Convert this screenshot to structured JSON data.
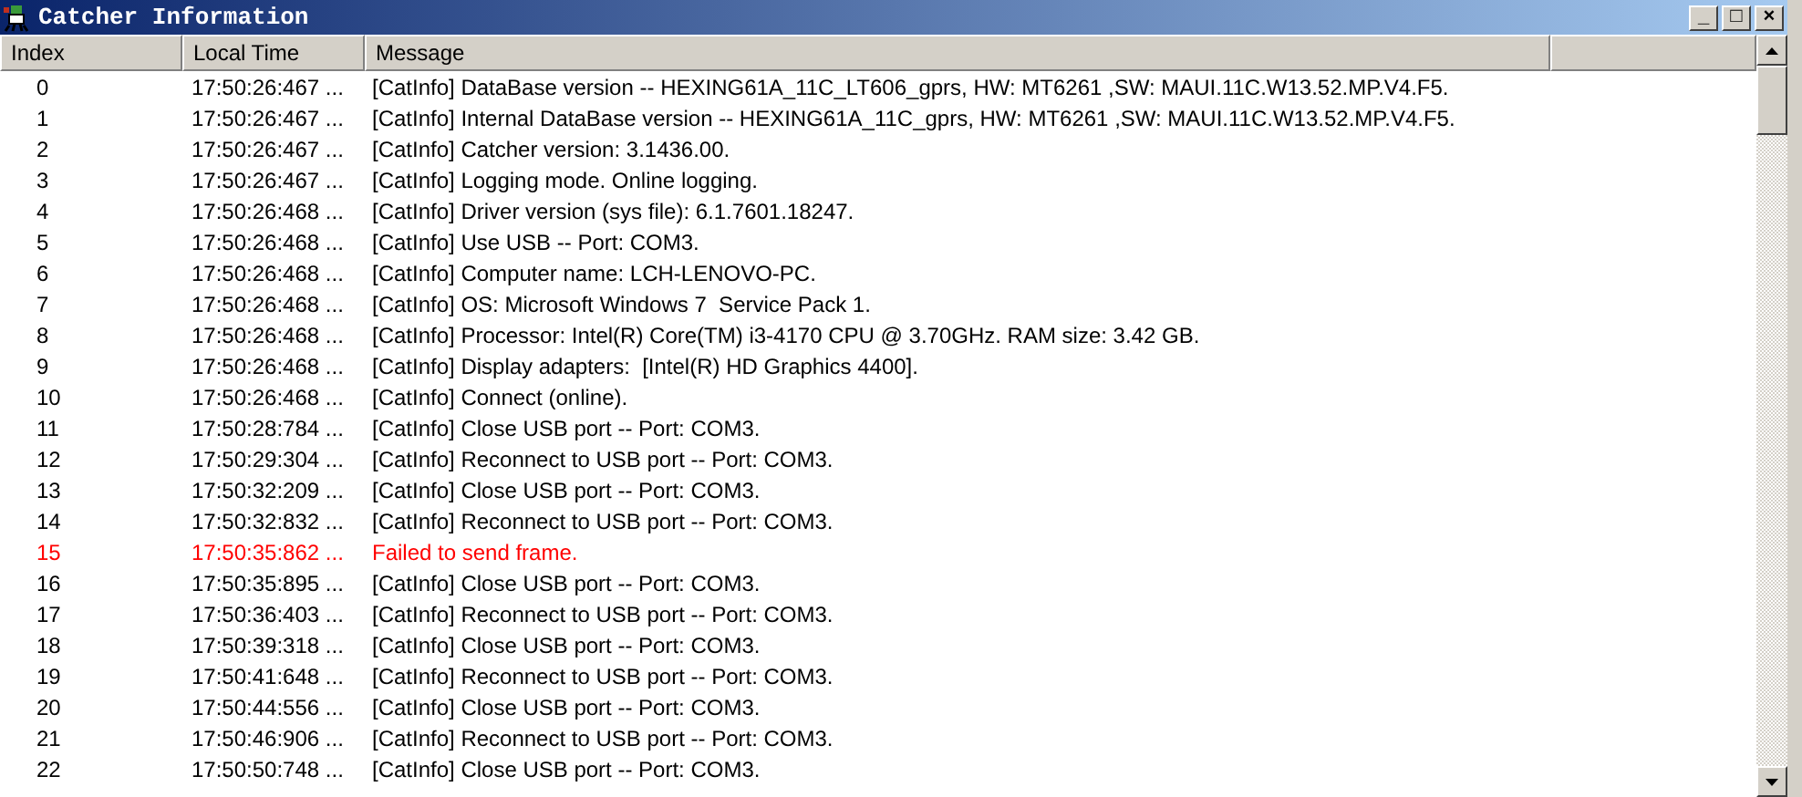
{
  "window": {
    "title": "Catcher Information",
    "controls": [
      "_",
      "□",
      "×"
    ]
  },
  "table": {
    "columns": [
      "Index",
      "Local Time",
      "Message"
    ],
    "rows": [
      {
        "index": "0",
        "time": "17:50:26:467 ...",
        "message": "[CatInfo] DataBase version -- HEXING61A_11C_LT606_gprs, HW: MT6261 ,SW: MAUI.11C.W13.52.MP.V4.F5.",
        "kind": "info"
      },
      {
        "index": "1",
        "time": "17:50:26:467 ...",
        "message": "[CatInfo] Internal DataBase version -- HEXING61A_11C_gprs, HW: MT6261 ,SW: MAUI.11C.W13.52.MP.V4.F5.",
        "kind": "info"
      },
      {
        "index": "2",
        "time": "17:50:26:467 ...",
        "message": "[CatInfo] Catcher version: 3.1436.00.",
        "kind": "info"
      },
      {
        "index": "3",
        "time": "17:50:26:467 ...",
        "message": "[CatInfo] Logging mode. Online logging.",
        "kind": "info"
      },
      {
        "index": "4",
        "time": "17:50:26:468 ...",
        "message": "[CatInfo] Driver version (sys file): 6.1.7601.18247.",
        "kind": "info"
      },
      {
        "index": "5",
        "time": "17:50:26:468 ...",
        "message": "[CatInfo] Use USB -- Port: COM3.",
        "kind": "info"
      },
      {
        "index": "6",
        "time": "17:50:26:468 ...",
        "message": "[CatInfo] Computer name: LCH-LENOVO-PC.",
        "kind": "info"
      },
      {
        "index": "7",
        "time": "17:50:26:468 ...",
        "message": "[CatInfo] OS: Microsoft Windows 7  Service Pack 1.",
        "kind": "info"
      },
      {
        "index": "8",
        "time": "17:50:26:468 ...",
        "message": "[CatInfo] Processor: Intel(R) Core(TM) i3-4170 CPU @ 3.70GHz. RAM size: 3.42 GB.",
        "kind": "info"
      },
      {
        "index": "9",
        "time": "17:50:26:468 ...",
        "message": "[CatInfo] Display adapters:  [Intel(R) HD Graphics 4400].",
        "kind": "info"
      },
      {
        "index": "10",
        "time": "17:50:26:468 ...",
        "message": "[CatInfo] Connect (online).",
        "kind": "info"
      },
      {
        "index": "11",
        "time": "17:50:28:784 ...",
        "message": "[CatInfo] Close USB port -- Port: COM3.",
        "kind": "info"
      },
      {
        "index": "12",
        "time": "17:50:29:304 ...",
        "message": "[CatInfo] Reconnect to USB port -- Port: COM3.",
        "kind": "info"
      },
      {
        "index": "13",
        "time": "17:50:32:209 ...",
        "message": "[CatInfo] Close USB port -- Port: COM3.",
        "kind": "info"
      },
      {
        "index": "14",
        "time": "17:50:32:832 ...",
        "message": "[CatInfo] Reconnect to USB port -- Port: COM3.",
        "kind": "info"
      },
      {
        "index": "15",
        "time": "17:50:35:862 ...",
        "message": "Failed to send frame.",
        "kind": "error"
      },
      {
        "index": "16",
        "time": "17:50:35:895 ...",
        "message": "[CatInfo] Close USB port -- Port: COM3.",
        "kind": "info"
      },
      {
        "index": "17",
        "time": "17:50:36:403 ...",
        "message": "[CatInfo] Reconnect to USB port -- Port: COM3.",
        "kind": "info"
      },
      {
        "index": "18",
        "time": "17:50:39:318 ...",
        "message": "[CatInfo] Close USB port -- Port: COM3.",
        "kind": "info"
      },
      {
        "index": "19",
        "time": "17:50:41:648 ...",
        "message": "[CatInfo] Reconnect to USB port -- Port: COM3.",
        "kind": "info"
      },
      {
        "index": "20",
        "time": "17:50:44:556 ...",
        "message": "[CatInfo] Close USB port -- Port: COM3.",
        "kind": "info"
      },
      {
        "index": "21",
        "time": "17:50:46:906 ...",
        "message": "[CatInfo] Reconnect to USB port -- Port: COM3.",
        "kind": "info"
      },
      {
        "index": "22",
        "time": "17:50:50:748 ...",
        "message": "[CatInfo] Close USB port -- Port: COM3.",
        "kind": "info"
      }
    ]
  }
}
